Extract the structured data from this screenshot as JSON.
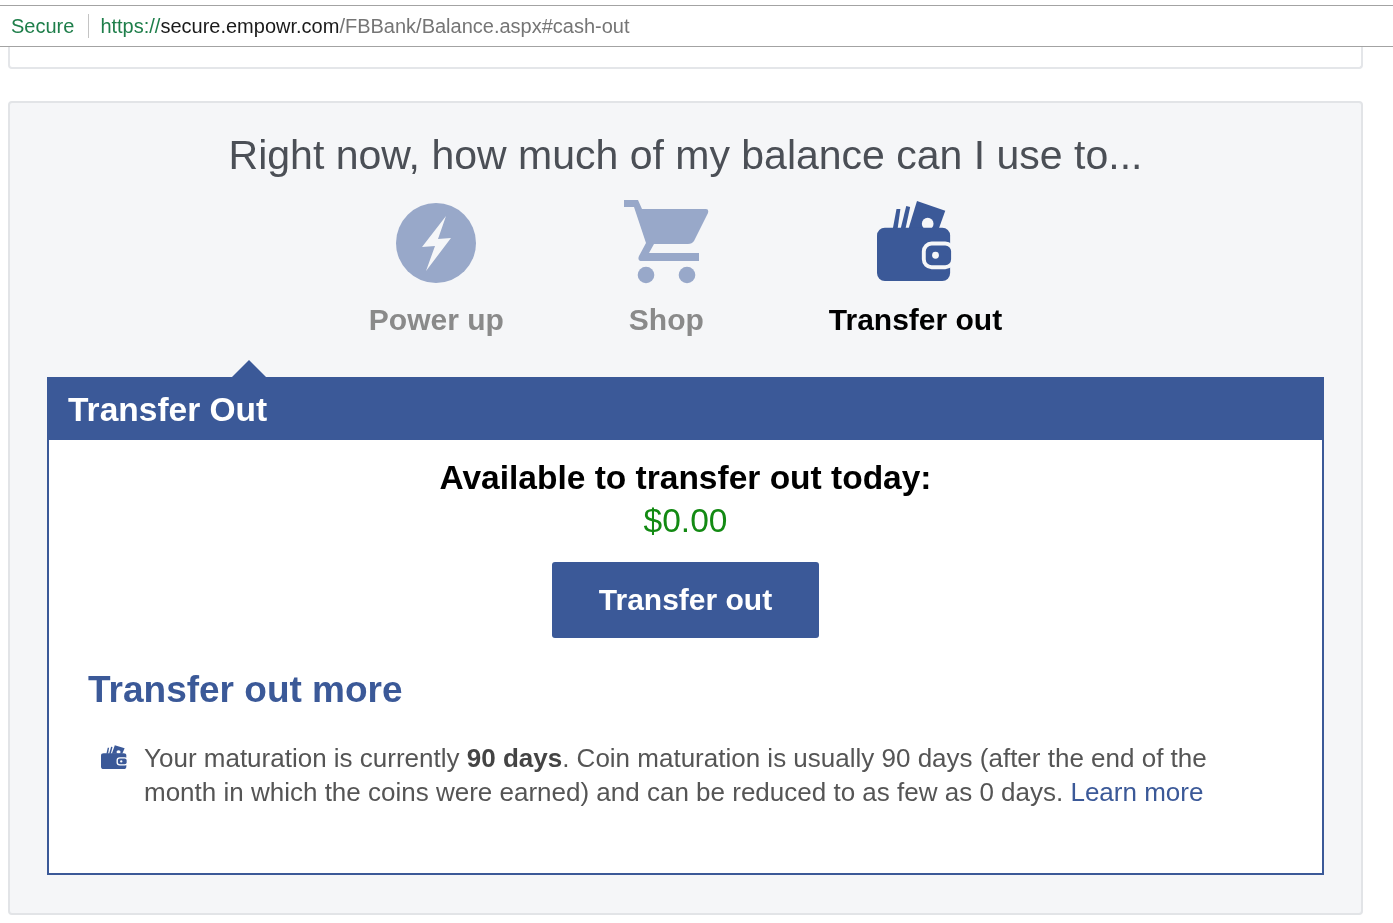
{
  "address_bar": {
    "security_label": "Secure",
    "url": {
      "scheme": "https://",
      "host": "secure.empowr.com",
      "path": "/FBBank/Balance.aspx#cash-out"
    }
  },
  "balance_card": {
    "heading": "Right now, how much of my balance can I use to...",
    "options": [
      {
        "kind": "power",
        "label": "Power up",
        "selected": false
      },
      {
        "kind": "shop",
        "label": "Shop",
        "selected": false
      },
      {
        "kind": "transfer",
        "label": "Transfer out",
        "selected": true
      }
    ],
    "panel": {
      "title": "Transfer Out",
      "available_label": "Available to transfer out today:",
      "available_amount": "$0.00",
      "button": "Transfer out",
      "section_title": "Transfer out more",
      "note": {
        "text": "Your maturation is currently **90 days**. Coin maturation is usually 90 days (after the end of the month in which the coins were earned) and can be reduced to as few as 0 days.",
        "link": "Learn more"
      }
    }
  }
}
